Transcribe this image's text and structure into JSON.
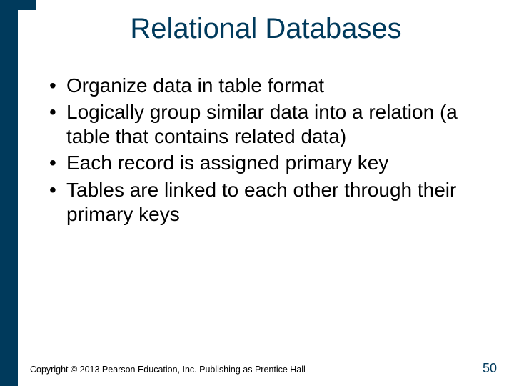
{
  "title": "Relational Databases",
  "bullets": [
    "Organize data in table format",
    "Logically group similar data into a relation (a table that contains related data)",
    "Each record is assigned primary key",
    "Tables are linked to each other through their primary keys"
  ],
  "footer": "Copyright © 2013 Pearson Education, Inc. Publishing as Prentice Hall",
  "page_number": "50"
}
